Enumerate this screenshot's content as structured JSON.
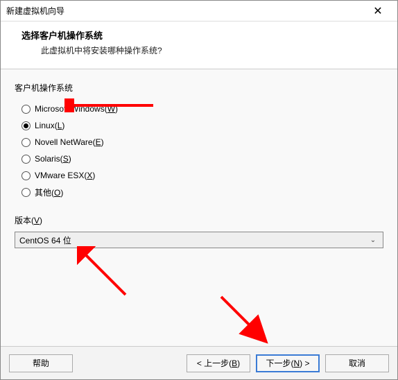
{
  "titlebar": {
    "title": "新建虚拟机向导"
  },
  "header": {
    "title": "选择客户机操作系统",
    "subtitle": "此虚拟机中将安装哪种操作系统?"
  },
  "os_group": {
    "label": "客户机操作系统",
    "options": [
      {
        "label": "Microsoft Windows(",
        "accel": "W",
        "tail": ")"
      },
      {
        "label": "Linux(",
        "accel": "L",
        "tail": ")"
      },
      {
        "label": "Novell NetWare(",
        "accel": "E",
        "tail": ")"
      },
      {
        "label": "Solaris(",
        "accel": "S",
        "tail": ")"
      },
      {
        "label": "VMware ESX(",
        "accel": "X",
        "tail": ")"
      },
      {
        "label": "其他(",
        "accel": "O",
        "tail": ")"
      }
    ],
    "selected_index": 1
  },
  "version": {
    "label_pre": "版本(",
    "accel": "V",
    "label_post": ")",
    "value": "CentOS 64 位"
  },
  "footer": {
    "help": "帮助",
    "back_pre": "< 上一步(",
    "back_accel": "B",
    "back_post": ")",
    "next_pre": "下一步(",
    "next_accel": "N",
    "next_post": ") >",
    "cancel": "取消"
  }
}
